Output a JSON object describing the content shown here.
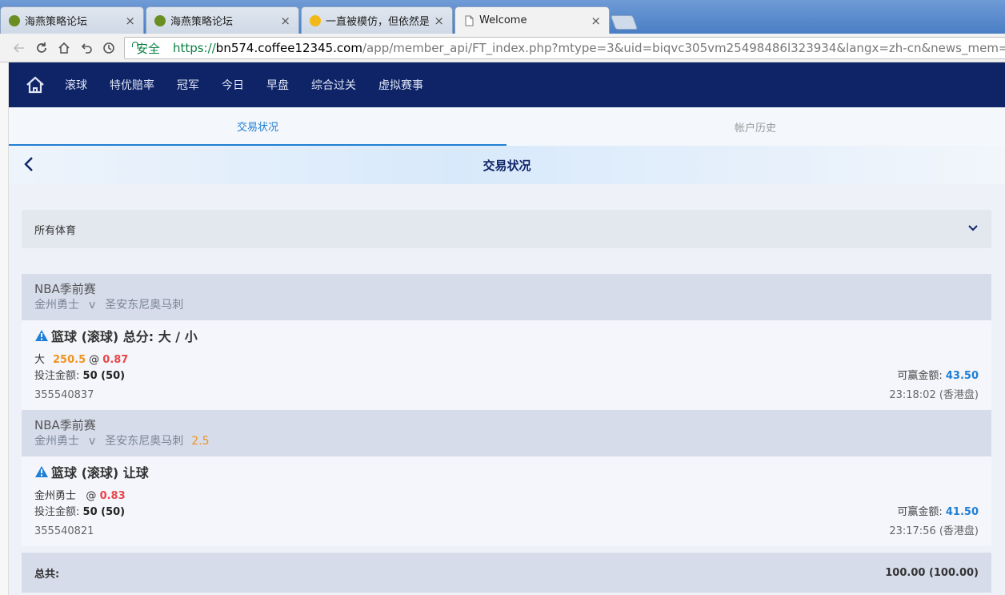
{
  "browser": {
    "tabs": [
      {
        "title": "海燕策略论坛",
        "favicon_color": "#6b8e23"
      },
      {
        "title": "海燕策略论坛",
        "favicon_color": "#6b8e23"
      },
      {
        "title": "一直被模仿，但依然是經",
        "favicon_color": "#f2b818"
      },
      {
        "title": "Welcome",
        "favicon_color": "#888888"
      }
    ],
    "close_glyph": "×",
    "security_label": "安全",
    "url_scheme": "https://",
    "url_host": "bn574.coffee12345.com",
    "url_path": "/app/member_api/FT_index.php?mtype=3&uid=biqvc305vm25498486l323934&langx=zh-cn&news_mem=Y&news_api=Y"
  },
  "nav": {
    "items": [
      "滚球",
      "特优赔率",
      "冠军",
      "今日",
      "早盘",
      "综合过关",
      "虚拟赛事"
    ]
  },
  "subtabs": {
    "active": "交易状况",
    "history": "帐户历史"
  },
  "page_title": "交易状况",
  "filter": {
    "label": "所有体育"
  },
  "bets": [
    {
      "league": "NBA季前赛",
      "home": "金州勇士",
      "vs": "v",
      "away": "圣安东尼奥马刺",
      "handicap": "",
      "market": "篮球 (滚球) 总分: 大 / 小",
      "selection": "大",
      "line": "250.5",
      "at": "@",
      "odds": "0.87",
      "stake_label": "投注金额:",
      "stake": "50 (50)",
      "win_label": "可赢金额:",
      "win": "43.50",
      "ticket": "355540837",
      "time": "23:18:02 (香港盘)"
    },
    {
      "league": "NBA季前赛",
      "home": "金州勇士",
      "vs": "v",
      "away": "圣安东尼奥马刺",
      "handicap": "2.5",
      "market": "篮球 (滚球) 让球",
      "selection": "金州勇士",
      "line": "",
      "at": "@",
      "odds": "0.83",
      "stake_label": "投注金额:",
      "stake": "50 (50)",
      "win_label": "可赢金额:",
      "win": "41.50",
      "ticket": "355540821",
      "time": "23:17:56 (香港盘)"
    }
  ],
  "total": {
    "label": "总共:",
    "value": "100.00 (100.00)"
  },
  "colors": {
    "nav_bg": "#0f2467",
    "accent_blue": "#1f7fd4",
    "odds_red": "#e8464a",
    "line_orange": "#f0931e"
  }
}
